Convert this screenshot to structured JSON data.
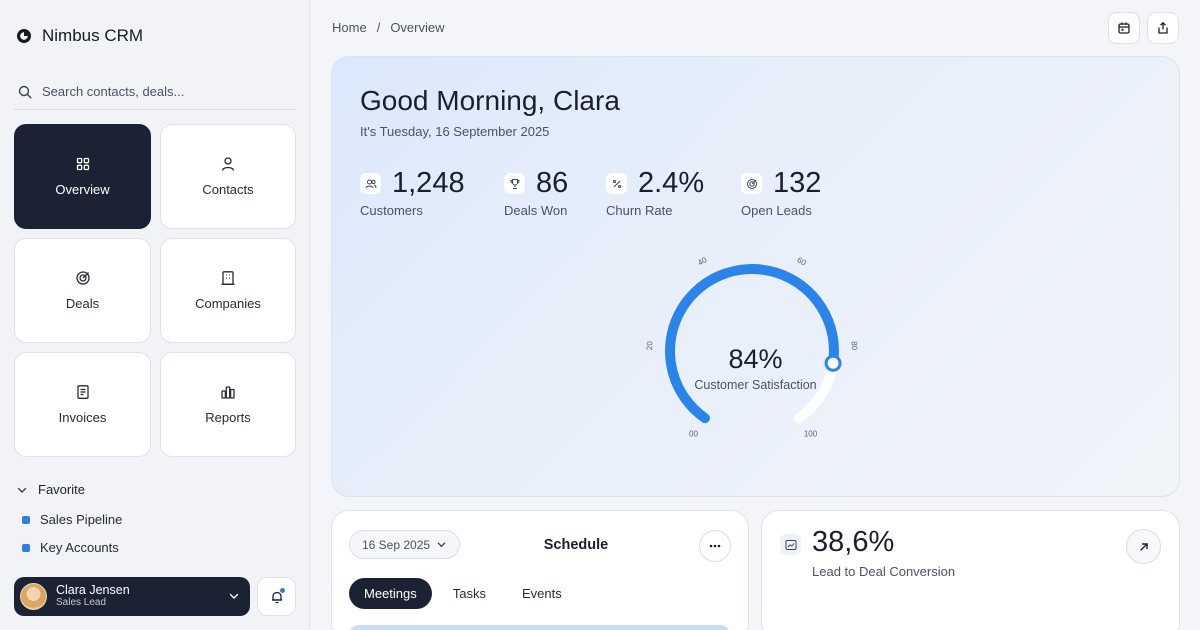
{
  "app": {
    "name": "Nimbus CRM"
  },
  "search": {
    "placeholder": "Search contacts, deals..."
  },
  "nav": {
    "tiles": [
      {
        "label": "Overview",
        "icon": "grid-icon",
        "active": true
      },
      {
        "label": "Contacts",
        "icon": "person-icon"
      },
      {
        "label": "Deals",
        "icon": "target-icon"
      },
      {
        "label": "Companies",
        "icon": "building-icon"
      },
      {
        "label": "Invoices",
        "icon": "receipt-icon"
      },
      {
        "label": "Reports",
        "icon": "bar-chart-icon"
      }
    ]
  },
  "favorites": {
    "title": "Favorite",
    "items": [
      {
        "label": "Sales Pipeline",
        "color": "#2f7de1"
      },
      {
        "label": "Key Accounts",
        "color": "#2f7de1"
      }
    ]
  },
  "user": {
    "name": "Clara Jensen",
    "role": "Sales Lead"
  },
  "breadcrumb": {
    "home": "Home",
    "separator": "/",
    "current": "Overview"
  },
  "hero": {
    "greeting": "Good Morning, Clara",
    "date": "It's Tuesday, 16 September 2025",
    "stats": [
      {
        "value": "1,248",
        "label": "Customers",
        "icon": "users-icon"
      },
      {
        "value": "86",
        "label": "Deals Won",
        "icon": "trophy-icon"
      },
      {
        "value": "2.4%",
        "label": "Churn Rate",
        "icon": "percent-icon"
      },
      {
        "value": "132",
        "label": "Open Leads",
        "icon": "target-icon"
      }
    ],
    "gauge": {
      "value_text": "84%",
      "value": 84,
      "label": "Customer Satisfaction",
      "ticks": [
        "00",
        "20",
        "40",
        "60",
        "80",
        "100"
      ],
      "color": "#2b84ea"
    }
  },
  "schedule": {
    "date": "16 Sep 2025",
    "title": "Schedule",
    "tabs": [
      {
        "label": "Meetings",
        "active": true
      },
      {
        "label": "Tasks"
      },
      {
        "label": "Events"
      }
    ]
  },
  "conversion": {
    "value": "38,6%",
    "label": "Lead to Deal Conversion"
  },
  "colors": {
    "accent": "#2f7de1",
    "dark": "#1b2233"
  }
}
